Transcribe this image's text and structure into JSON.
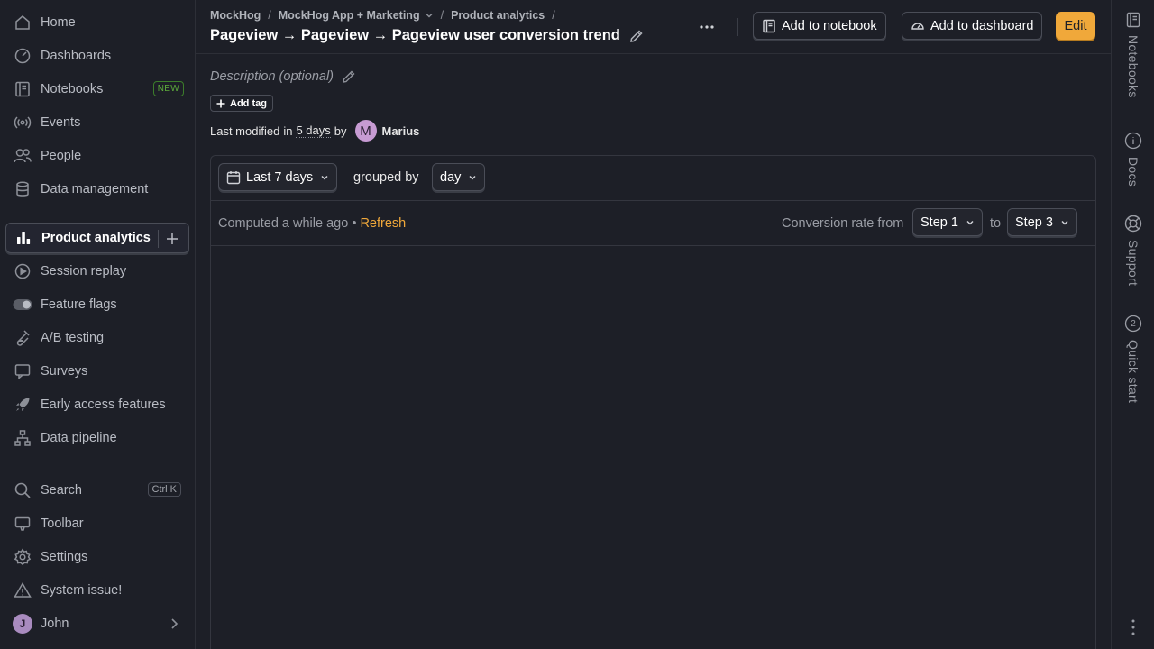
{
  "sidebar": {
    "items": [
      {
        "label": "Home",
        "icon": "home-icon"
      },
      {
        "label": "Dashboards",
        "icon": "dashboard-gauge-icon"
      },
      {
        "label": "Notebooks",
        "icon": "notebook-icon",
        "badge": "NEW"
      },
      {
        "label": "Events",
        "icon": "broadcast-icon"
      },
      {
        "label": "People",
        "icon": "people-icon"
      },
      {
        "label": "Data management",
        "icon": "database-icon"
      },
      {
        "label": "Product analytics",
        "icon": "bar-chart-icon",
        "active": true
      },
      {
        "label": "Session replay",
        "icon": "replay-icon"
      },
      {
        "label": "Feature flags",
        "icon": "toggle-icon"
      },
      {
        "label": "A/B testing",
        "icon": "flask-icon"
      },
      {
        "label": "Surveys",
        "icon": "chat-bubble-icon"
      },
      {
        "label": "Early access features",
        "icon": "rocket-icon"
      },
      {
        "label": "Data pipeline",
        "icon": "pipeline-icon"
      }
    ],
    "bottom": [
      {
        "label": "Search",
        "icon": "search-icon",
        "shortcut": "Ctrl K"
      },
      {
        "label": "Toolbar",
        "icon": "toolbar-icon"
      },
      {
        "label": "Settings",
        "icon": "gear-icon"
      },
      {
        "label": "System issue!",
        "icon": "warning-icon"
      },
      {
        "label": "John",
        "avatar": "J"
      }
    ]
  },
  "header": {
    "breadcrumbs": [
      "MockHog",
      "MockHog App + Marketing",
      "Product analytics"
    ],
    "title": "Pageview → Pageview → Pageview user conversion trend",
    "buttons": {
      "add_to_notebook": "Add to notebook",
      "add_to_dashboard": "Add to dashboard",
      "edit": "Edit"
    }
  },
  "insight": {
    "description_placeholder": "Description (optional)",
    "add_tag": "Add tag",
    "last_modified": {
      "prefix": "Last modified",
      "in": "in",
      "when": "5 days",
      "by": "by",
      "author_initial": "M",
      "author": "Marius"
    },
    "filters": {
      "date_range": "Last 7 days",
      "grouped_by_label": "grouped by",
      "interval": "day"
    },
    "status": {
      "computed": "Computed a while ago",
      "bullet": "•",
      "refresh": "Refresh"
    },
    "conversion": {
      "label": "Conversion rate from",
      "from_step": "Step 1",
      "to_label": "to",
      "to_step": "Step 3"
    }
  },
  "rightbar": {
    "items": [
      {
        "label": "Notebooks",
        "icon": "notebook-icon"
      },
      {
        "label": "Docs",
        "icon": "info-icon"
      },
      {
        "label": "Support",
        "icon": "lifebuoy-icon"
      },
      {
        "label": "Quick start",
        "icon": "progress-icon",
        "count": "2"
      }
    ]
  }
}
